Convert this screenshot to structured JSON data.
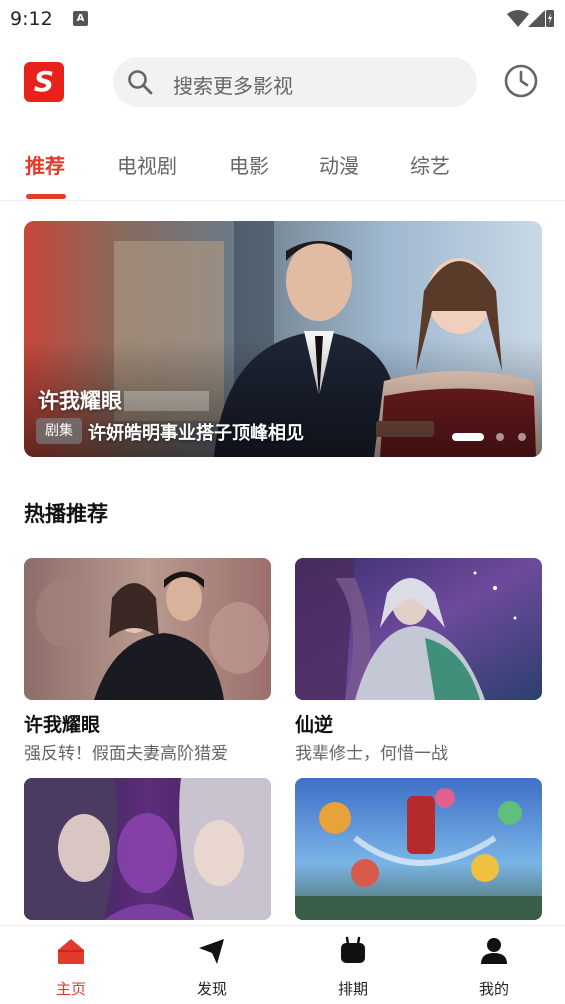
{
  "status_bar": {
    "time": "9:12",
    "notification_letter": "A"
  },
  "header": {
    "logo_letter": "S",
    "search_placeholder": "搜索更多影视"
  },
  "tabs": [
    {
      "label": "推荐",
      "active": true
    },
    {
      "label": "电视剧",
      "active": false
    },
    {
      "label": "电影",
      "active": false
    },
    {
      "label": "动漫",
      "active": false
    },
    {
      "label": "综艺",
      "active": false
    }
  ],
  "banner": {
    "title": "许我耀眼",
    "tag": "剧集",
    "subtitle": "许妍皓明事业搭子顶峰相见",
    "dots": 3,
    "active_dot": 0
  },
  "section": {
    "title": "热播推荐",
    "cards": [
      {
        "title": "许我耀眼",
        "desc": "强反转！假面夫妻高阶猎爱"
      },
      {
        "title": "仙逆",
        "desc": "我辈修士，何惜一战"
      },
      {
        "title": "",
        "desc": ""
      },
      {
        "title": "",
        "desc": ""
      }
    ]
  },
  "bottom_nav": [
    {
      "label": "主页",
      "icon": "home-icon",
      "active": true
    },
    {
      "label": "发现",
      "icon": "discover-icon",
      "active": false
    },
    {
      "label": "排期",
      "icon": "schedule-icon",
      "active": false
    },
    {
      "label": "我的",
      "icon": "profile-icon",
      "active": false
    }
  ],
  "colors": {
    "accent": "#e33b2b",
    "logo": "#e8221b"
  }
}
